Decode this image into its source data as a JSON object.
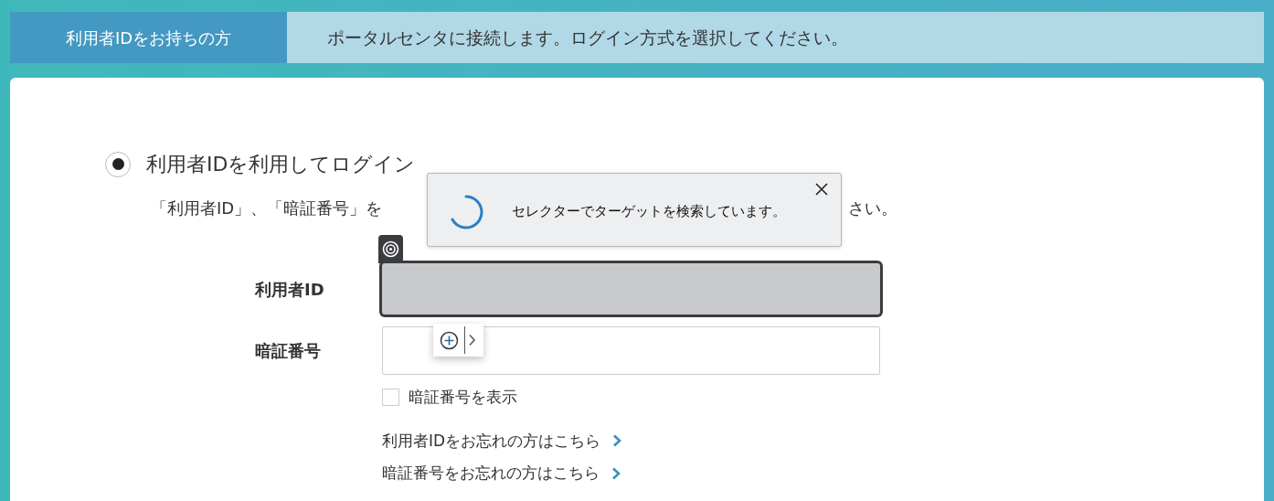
{
  "header": {
    "tab": "利用者IDをお持ちの方",
    "message": "ポータルセンタに接続します。ログイン方式を選択してください。"
  },
  "login_option": {
    "label": "利用者IDを利用してログイン",
    "selected": true
  },
  "instruction": {
    "start": "「利用者ID」、「暗証番号」を",
    "end": "さい。"
  },
  "popup": {
    "message": "セレクターでターゲットを検索しています。"
  },
  "fields": [
    {
      "label": "利用者ID",
      "highlighted": true
    },
    {
      "label": "暗証番号",
      "highlighted": false
    }
  ],
  "show_pin": {
    "label": "暗証番号を表示",
    "checked": false
  },
  "links": [
    "利用者IDをお忘れの方はこちら",
    "暗証番号をお忘れの方はこちら"
  ]
}
